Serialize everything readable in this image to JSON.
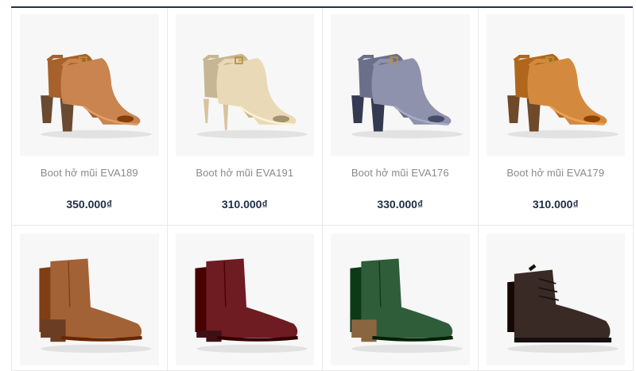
{
  "products": [
    {
      "name": "Boot hở mũi EVA189",
      "price": "350.000₫",
      "color": "#c9844f",
      "heel": "#6b4a32",
      "style": "open"
    },
    {
      "name": "Boot hở mũi EVA191",
      "price": "310.000₫",
      "color": "#ead9b6",
      "heel": "#d9c29c",
      "style": "open-stiletto"
    },
    {
      "name": "Boot hở mũi EVA176",
      "price": "330.000₫",
      "color": "#8f92ad",
      "heel": "#353a52",
      "style": "open"
    },
    {
      "name": "Boot hở mũi EVA179",
      "price": "310.000₫",
      "color": "#d38a3f",
      "heel": "#6e4a2a",
      "style": "open"
    },
    {
      "color": "#a36136",
      "heel": "#6b3d22",
      "style": "ankle"
    },
    {
      "color": "#6e1b22",
      "heel": "#3f1013",
      "style": "ankle-low"
    },
    {
      "color": "#2f5d3a",
      "heel": "#8a6640",
      "style": "ankle"
    },
    {
      "color": "#3a2a26",
      "heel": "#1f1614",
      "style": "lace"
    }
  ]
}
